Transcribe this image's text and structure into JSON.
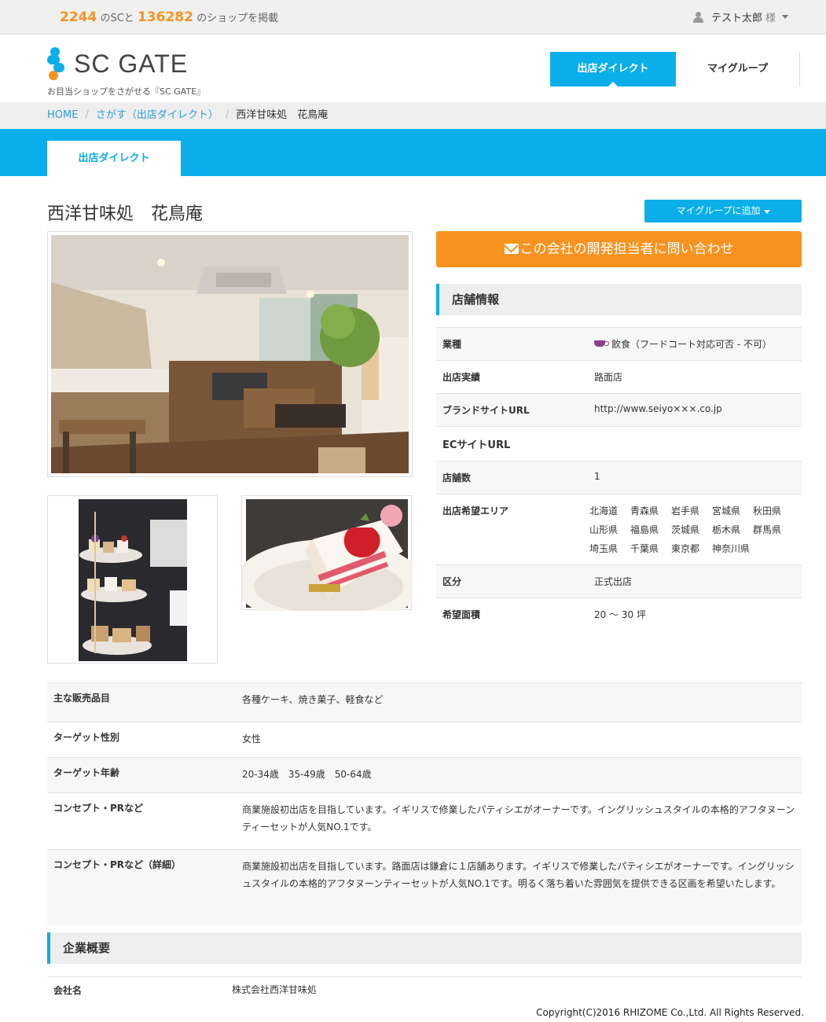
{
  "topbar": {
    "sc_count": "2244",
    "sc_suffix": "のSCと",
    "shop_count": "136282",
    "shop_suffix": "のショップを掲載",
    "user_name": "テスト太郎",
    "user_honorific": "様"
  },
  "header": {
    "logo_text": "SC GATE",
    "tagline": "お目当ショップをさがせる『SC GATE』",
    "nav": [
      "出店ダイレクト",
      "マイグループ"
    ]
  },
  "breadcrumb": [
    "HOME",
    "さがす（出店ダイレクト）",
    "西洋甘味処　花鳥庵"
  ],
  "band_tab": "出店ダイレクト",
  "shop": {
    "title": "西洋甘味処　花鳥庵",
    "mygroup_button": "マイグループに追加",
    "contact_button": "この会社の開発担当者に問い合わせ"
  },
  "store_info": {
    "heading": "店舗情報",
    "rows": [
      {
        "label": "業種",
        "value": "飲食（フードコート対応可否 - 不可）",
        "icon": "cup-icon"
      },
      {
        "label": "出店実績",
        "value": "路面店"
      },
      {
        "label": "ブランドサイトURL",
        "value": "http://www.seiyo×××.co.jp"
      },
      {
        "label": "ECサイトURL",
        "value": ""
      },
      {
        "label": "店舗数",
        "value": "1"
      },
      {
        "label": "出店希望エリア",
        "areas": [
          "北海道",
          "青森県",
          "岩手県",
          "宮城県",
          "秋田県",
          "山形県",
          "福島県",
          "茨城県",
          "栃木県",
          "群馬県",
          "埼玉県",
          "千葉県",
          "東京都",
          "神奈川県"
        ]
      },
      {
        "label": "区分",
        "value": "正式出店"
      },
      {
        "label": "希望面積",
        "value": "20 ～ 30 坪"
      }
    ]
  },
  "details": [
    {
      "label": "主な販売品目",
      "value": "各種ケーキ、焼き菓子、軽食など"
    },
    {
      "label": "ターゲット性別",
      "value": "女性"
    },
    {
      "label": "ターゲット年齢",
      "value": "20-34歳　35-49歳　50-64歳"
    },
    {
      "label": "コンセプト・PRなど",
      "value": "商業施設初出店を目指しています。イギリスで修業したパティシエがオーナーです。イングリッシュスタイルの本格的アフタヌーンティーセットが人気NO.1です。"
    },
    {
      "label": "コンセプト・PRなど（詳細）",
      "value": "商業施設初出店を目指しています。路面店は鎌倉に１店舗あります。イギリスで修業したパティシエがオーナーです。イングリッシュスタイルの本格的アフタヌーンティーセットが人気NO.1です。明るく落ち着いた雰囲気を提供できる区画を希望いたします。"
    }
  ],
  "company": {
    "heading": "企業概要",
    "label": "会社名",
    "value": "株式会社西洋甘味処"
  },
  "copyright": "Copyright(C)2016 RHIZOME Co.,Ltd. All Rights Reserved."
}
